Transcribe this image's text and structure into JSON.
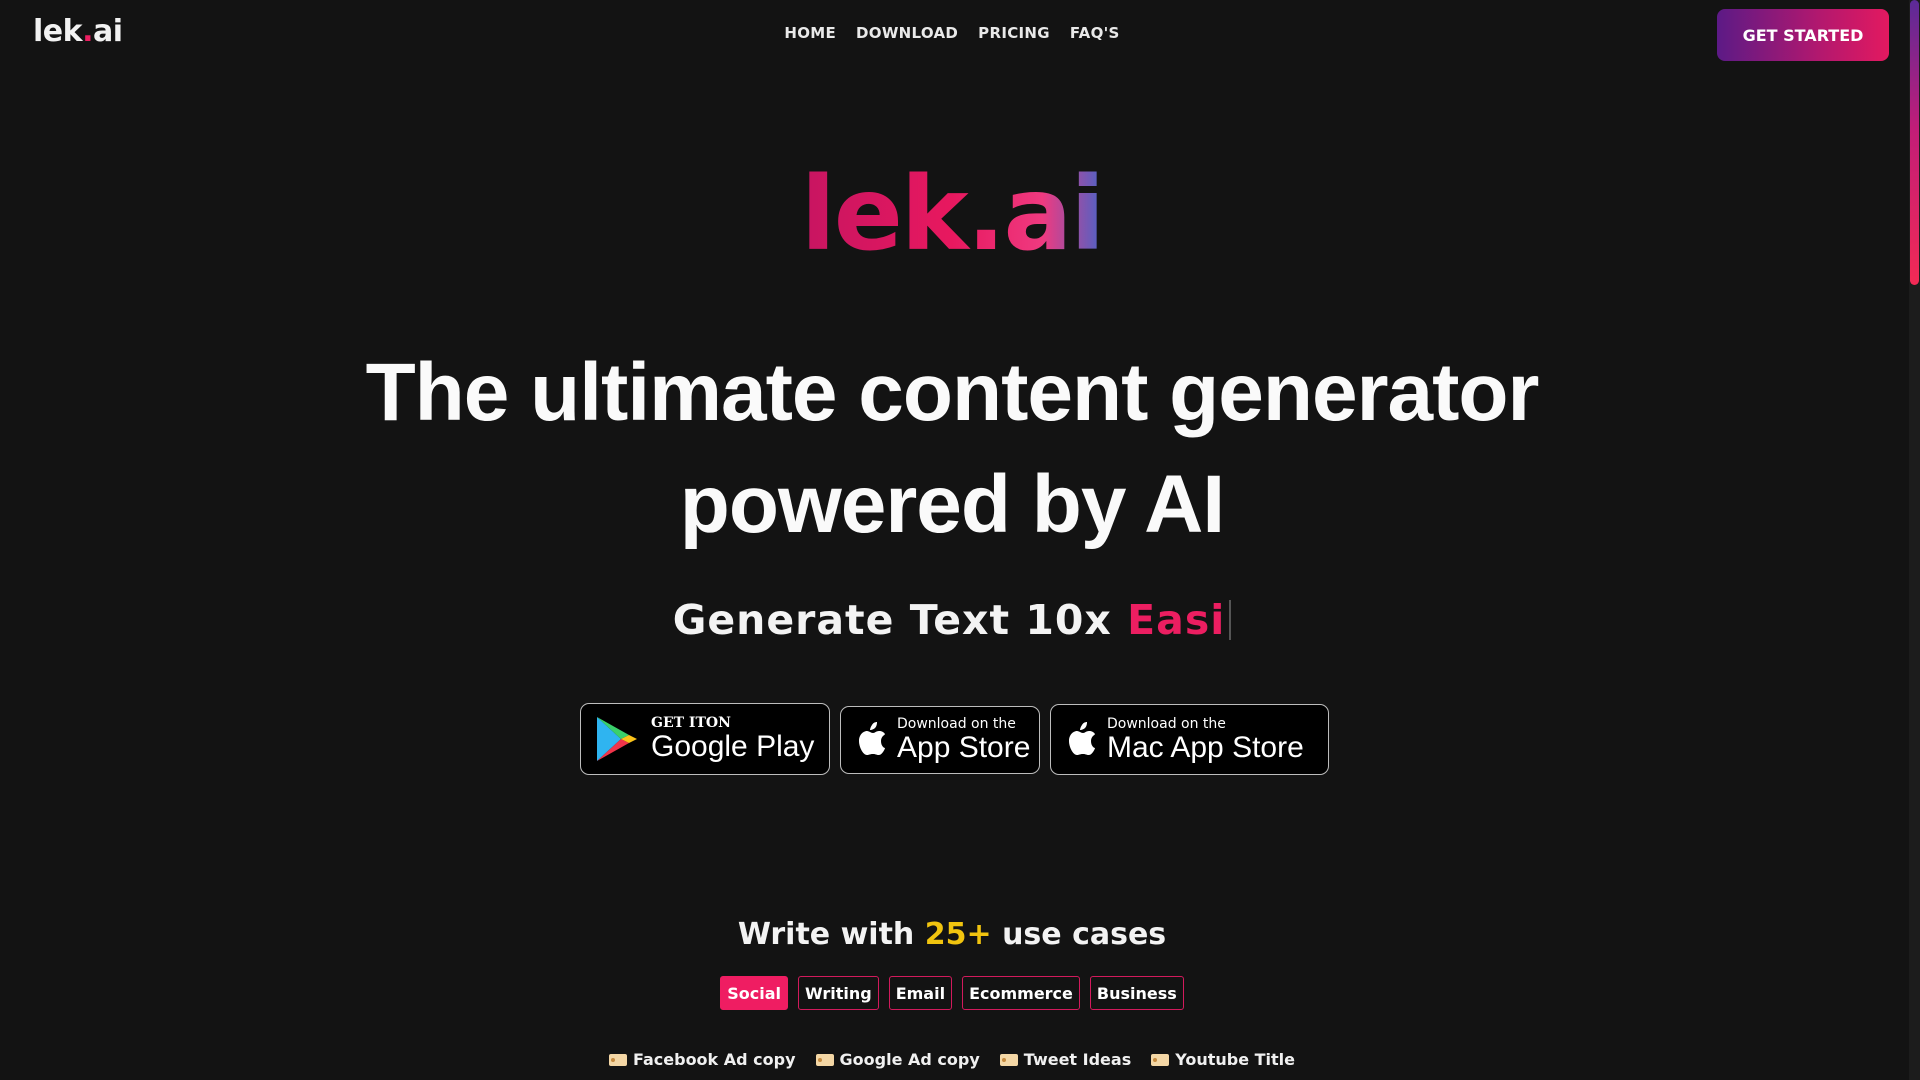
{
  "header": {
    "logo_prefix": "lek",
    "logo_dot": ".",
    "logo_suffix": "ai",
    "nav": [
      "HOME",
      "DOWNLOAD",
      "PRICING",
      "FAQ'S"
    ],
    "cta": "GET STARTED"
  },
  "hero": {
    "brand": "lek.ai",
    "headline_line1": "The ultimate content generator",
    "headline_line2": "powered by AI",
    "sub_prefix": "Generate Text 10x ",
    "sub_accent": "Easi"
  },
  "stores": {
    "google": {
      "small": "GET ITON",
      "big": "Google Play",
      "icon": "google-play-icon"
    },
    "app": {
      "small": "Download on the",
      "big": "App Store",
      "icon": "apple-icon"
    },
    "mac": {
      "small": "Download on the",
      "big": "Mac App Store",
      "icon": "apple-icon"
    }
  },
  "use_cases": {
    "title_prefix": "Write with ",
    "title_num": "25+",
    "title_suffix": " use cases",
    "tabs": [
      "Social",
      "Writing",
      "Email",
      "Ecommerce",
      "Business"
    ],
    "active_tab": "Social",
    "items": [
      "Facebook Ad copy",
      "Google Ad copy",
      "Tweet Ideas",
      "Youtube Title"
    ]
  },
  "colors": {
    "accent": "#ec1e61",
    "highlight": "#f1c40f",
    "background": "#131313"
  }
}
